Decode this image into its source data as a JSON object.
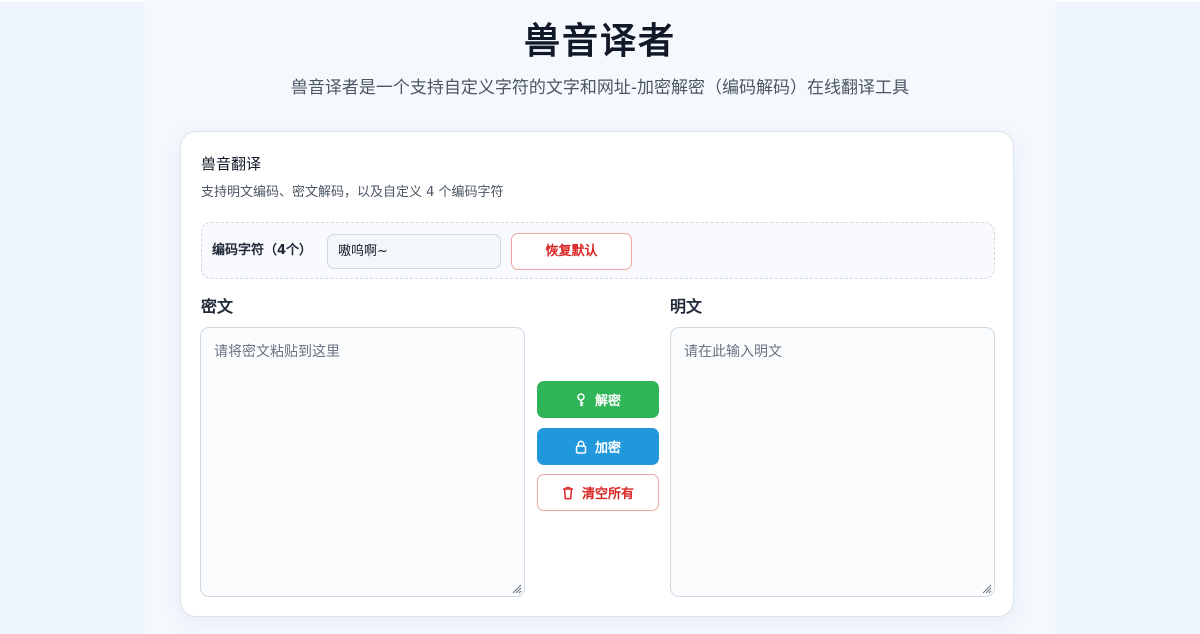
{
  "header": {
    "title": "兽音译者",
    "subtitle": "兽音译者是一个支持自定义字符的文字和网址-加密解密（编码解码）在线翻译工具"
  },
  "card": {
    "title": "兽音翻译",
    "description": "支持明文编码、密文解码，以及自定义 4 个编码字符",
    "encoding": {
      "label": "编码字符（4个）",
      "value": "嗷呜啊~",
      "reset_label": "恢复默认"
    },
    "cipher": {
      "label": "密文",
      "placeholder": "请将密文粘贴到这里"
    },
    "plain": {
      "label": "明文",
      "placeholder": "请在此输入明文"
    },
    "actions": {
      "decrypt_label": "解密",
      "encrypt_label": "加密",
      "clear_label": "清空所有"
    }
  },
  "icons": {
    "decrypt": "key-icon",
    "encrypt": "lock-icon",
    "clear": "trash-icon"
  },
  "colors": {
    "decrypt": "#2fb457",
    "encrypt": "#2197dc",
    "danger": "#dc2626",
    "page_bg": "#eef5fd"
  }
}
